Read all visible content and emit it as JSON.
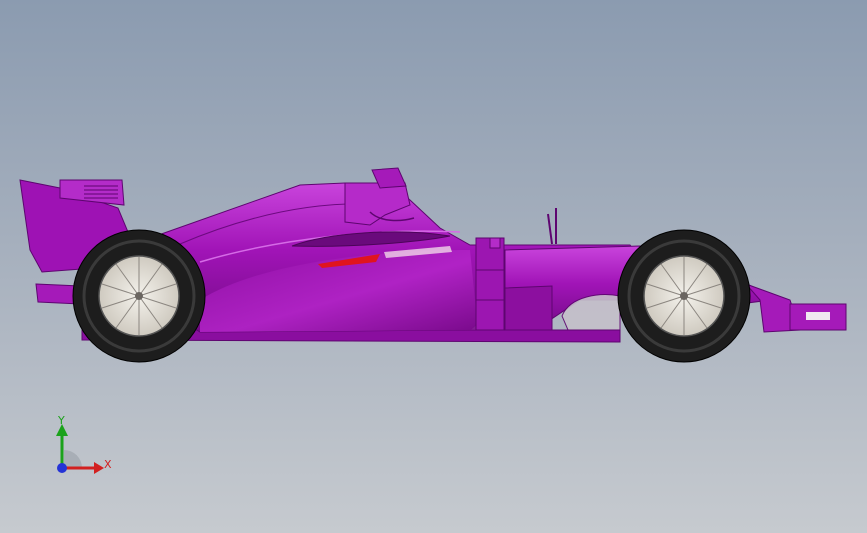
{
  "viewport": {
    "background_top": "#8b9bb0",
    "background_bottom": "#c6cacf"
  },
  "model": {
    "body_color": "#a114b7",
    "body_dark": "#7a0a8c",
    "body_light": "#c944dc",
    "accent_color": "#e0141e",
    "rim_color": "#e9e6df",
    "tire_color": "#1d1d1d"
  },
  "triad": {
    "x_label": "X",
    "y_label": "Y",
    "x_color": "#d22020",
    "y_color": "#1ba21b",
    "z_color": "#2433d6"
  }
}
